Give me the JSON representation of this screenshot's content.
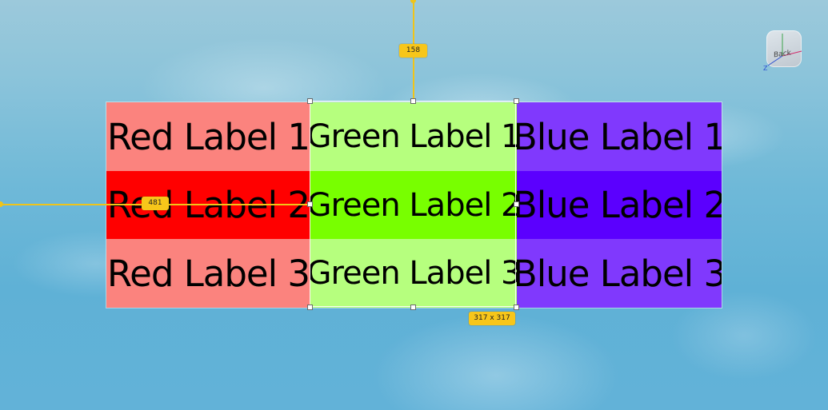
{
  "labels": {
    "red": [
      "Red Label 1",
      "Red Label 2",
      "Red Label 3"
    ],
    "green": [
      "Green Label 1",
      "Green Label 2",
      "Green Label 3"
    ],
    "blue": [
      "Blue Label 1",
      "Blue Label 2",
      "Blue Label 3"
    ]
  },
  "colors": {
    "red_light": "#fb837e",
    "red_strong": "#ff0000",
    "green_light": "#b6ff7e",
    "green_strong": "#78ff00",
    "blue_light": "#8039fd",
    "blue_strong": "#5b00fe",
    "guide": "#f0c419"
  },
  "guides": {
    "top_distance": "158",
    "left_distance": "481",
    "selection_size": "317 x 317"
  },
  "view_gizmo": {
    "face_label": "Back",
    "axis_label": "Z"
  }
}
